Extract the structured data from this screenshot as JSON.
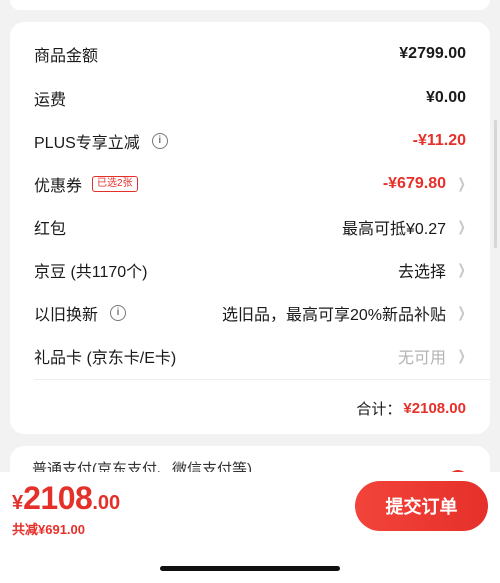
{
  "fees": {
    "goods_amount": {
      "label": "商品金额",
      "value": "¥2799.00"
    },
    "shipping": {
      "label": "运费",
      "value": "¥0.00"
    },
    "plus_discount": {
      "label": "PLUS专享立减",
      "value": "-¥11.20"
    },
    "coupon": {
      "label": "优惠券",
      "badge": "已选2张",
      "value": "-¥679.80"
    },
    "red_packet": {
      "label": "红包",
      "value": "最高可抵¥0.27"
    },
    "jd_beans": {
      "label": "京豆 (共1170个)",
      "value": "去选择"
    },
    "trade_in": {
      "label": "以旧换新",
      "value": "选旧品，最高可享20%新品补贴"
    },
    "gift_card": {
      "label": "礼品卡 (京东卡/E卡)",
      "value": "无可用"
    }
  },
  "total": {
    "label": "合计：",
    "value": "¥2108.00"
  },
  "payment_peek": "普通支付(京东支付、微信支付等)",
  "bottom": {
    "currency": "¥",
    "pay_int": "2108",
    "pay_dec": ".00",
    "saved": "共减¥691.00",
    "submit_label": "提交订单"
  },
  "colors": {
    "accent": "#e5302a",
    "background": "#f2f2f2"
  },
  "icons": {
    "info": "info-icon",
    "chevron": "chevron-right-icon"
  }
}
